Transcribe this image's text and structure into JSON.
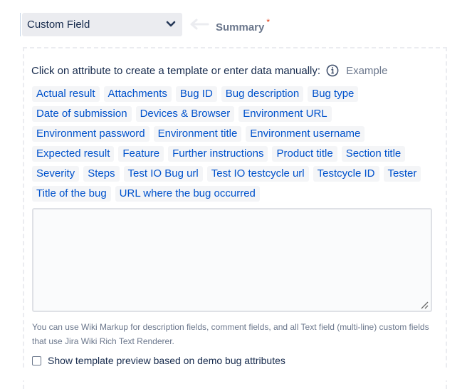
{
  "mapping": {
    "source_select": {
      "value": "Custom Field"
    },
    "target_field": {
      "label": "Summary",
      "required_marker": "*"
    }
  },
  "template": {
    "intro_text": "Click on attribute to create a template or enter data manually:",
    "example_link": "Example",
    "attributes": [
      "Actual result",
      "Attachments",
      "Bug ID",
      "Bug description",
      "Bug type",
      "Date of submission",
      "Devices & Browser",
      "Environment URL",
      "Environment password",
      "Environment title",
      "Environment username",
      "Expected result",
      "Feature",
      "Further instructions",
      "Product title",
      "Section title",
      "Severity",
      "Steps",
      "Test IO Bug url",
      "Test IO testcycle url",
      "Testcycle ID",
      "Tester",
      "Title of the bug",
      "URL where the bug occurred"
    ],
    "textarea_value": "",
    "help_text": "You can use Wiki Markup for description fields, comment fields, and all Text field (multi-line) custom fields that use Jira Wiki Rich Text Renderer.",
    "preview_checkbox": {
      "label": "Show template preview based on demo bug attributes",
      "checked": false
    }
  },
  "colors": {
    "accent": "#0052cc",
    "chip_bg": "#f4f5f7",
    "required": "#de350b",
    "muted": "#6b778c"
  }
}
